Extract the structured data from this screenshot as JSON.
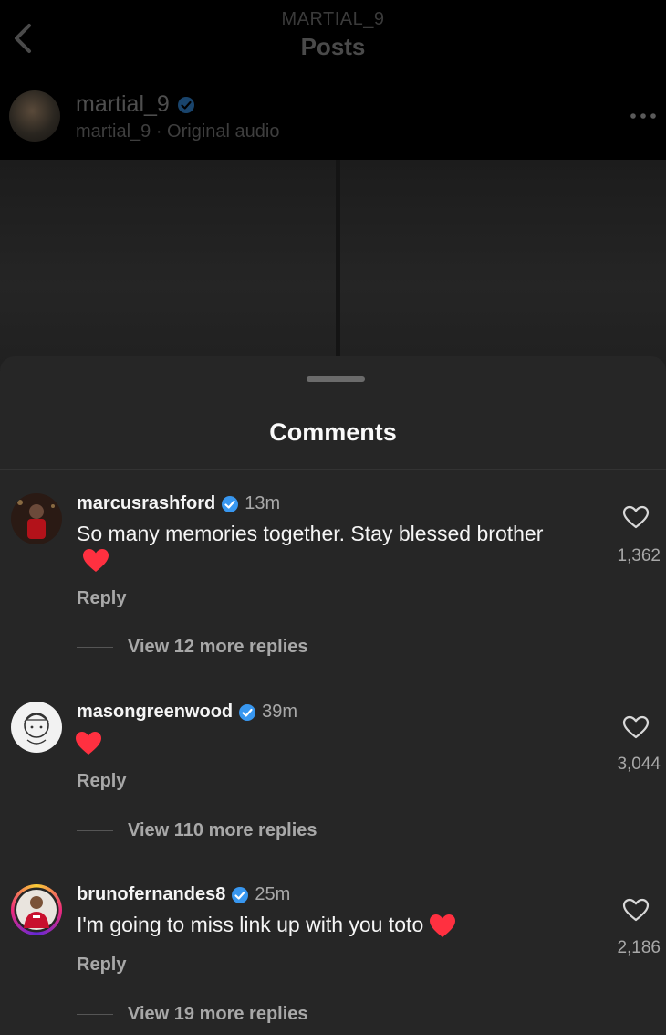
{
  "header": {
    "subtitle": "MARTIAL_9",
    "title": "Posts"
  },
  "post": {
    "username": "martial_9",
    "audio_line": "martial_9 · Original audio"
  },
  "comments_sheet": {
    "title": "Comments",
    "comments": [
      {
        "username": "marcusrashford",
        "time": "13m",
        "text": "So many memories together. Stay blessed brother",
        "emoji": "red-heart",
        "reply_label": "Reply",
        "likes": "1,362",
        "view_replies": "View 12 more replies"
      },
      {
        "username": "masongreenwood",
        "time": "39m",
        "text": "",
        "emoji": "red-heart",
        "reply_label": "Reply",
        "likes": "3,044",
        "view_replies": "View 110 more replies"
      },
      {
        "username": "brunofernandes8",
        "time": "25m",
        "text": "I'm going to miss link up with you toto",
        "emoji": "red-heart",
        "reply_label": "Reply",
        "likes": "2,186",
        "view_replies": "View 19 more replies"
      }
    ]
  },
  "colors": {
    "background": "#000000",
    "sheet": "#262626",
    "verified": "#3897f0",
    "heart": "#ff3040",
    "story_ring_start": "#f9ce34",
    "story_ring_end": "#ee2a7b"
  },
  "icons": [
    "back-chevron-icon",
    "verified-badge-icon",
    "more-options-icon",
    "heart-outline-icon",
    "red-heart-emoji"
  ]
}
